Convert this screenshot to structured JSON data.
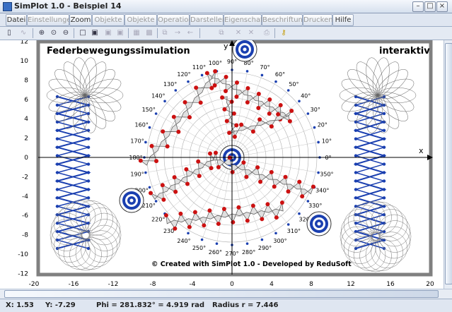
{
  "window": {
    "title": "SimPlot 1.0 - Beispiel 14",
    "buttons": [
      "–",
      "□",
      "×"
    ]
  },
  "menu": {
    "items": [
      {
        "label": "Datei",
        "enabled": true
      },
      {
        "label": "Einstellungen",
        "enabled": false
      },
      {
        "label": "Zoom",
        "enabled": true
      },
      {
        "label": "Objekte I",
        "enabled": false
      },
      {
        "label": "Objekte II",
        "enabled": false
      },
      {
        "label": "Operation",
        "enabled": false
      },
      {
        "label": "Darstellen",
        "enabled": false
      },
      {
        "label": "Eigenschaft",
        "enabled": false
      },
      {
        "label": "Beschriftung",
        "enabled": false
      },
      {
        "label": "Drucken",
        "enabled": false
      },
      {
        "label": "Hilfe",
        "enabled": true
      }
    ]
  },
  "toolbar": {
    "icons": [
      "calculator-icon",
      "function-icon",
      "zoom-in-icon",
      "zoom-region-icon",
      "zoom-out-icon",
      "square-icon",
      "circle-frame-icon",
      "circle-frame-2-icon",
      "grid-icon",
      "image-icon",
      "arrange-icon",
      "arrow-right-icon",
      "arrow-left-icon",
      "copy-icon",
      "cross-icon",
      "cross-2-icon",
      "print-icon",
      "help-key-icon"
    ]
  },
  "plot": {
    "title": "Federbewegungssimulation",
    "tag": "interaktiv",
    "credit": "© Created with SimPlot 1.0 - Developed by ReduSoft",
    "x_axis_label": "x",
    "y_axis_label": "y",
    "x_ticks": [
      "-20",
      "-16",
      "-12",
      "-8",
      "-4",
      "0",
      "4",
      "8",
      "12",
      "16",
      "20"
    ],
    "y_ticks": [
      "12",
      "10",
      "8",
      "6",
      "4",
      "2",
      "0",
      "-2",
      "-4",
      "-6",
      "-8",
      "-10",
      "-12"
    ],
    "polar_angle_labels": [
      "0°",
      "10°",
      "20°",
      "30°",
      "40°",
      "50°",
      "60°",
      "70°",
      "80°",
      "90°",
      "100°",
      "110°",
      "120°",
      "130°",
      "140°",
      "150°",
      "160°",
      "170°",
      "180°",
      "190°",
      "200°",
      "210°",
      "220°",
      "230°",
      "240°",
      "250°",
      "260°",
      "270°",
      "280°",
      "290°",
      "300°",
      "310°",
      "320°",
      "330°",
      "340°",
      "350°"
    ],
    "colors": {
      "accent_blue": "#1a3fb0",
      "mass_red": "#cc1111",
      "frame_gray": "#808080"
    }
  },
  "status": {
    "x": "X: 1.53",
    "y": "Y: -7.29",
    "phi": "Phi = 281.832° = 4.919 rad",
    "radius": "Radius r = 7.446"
  }
}
